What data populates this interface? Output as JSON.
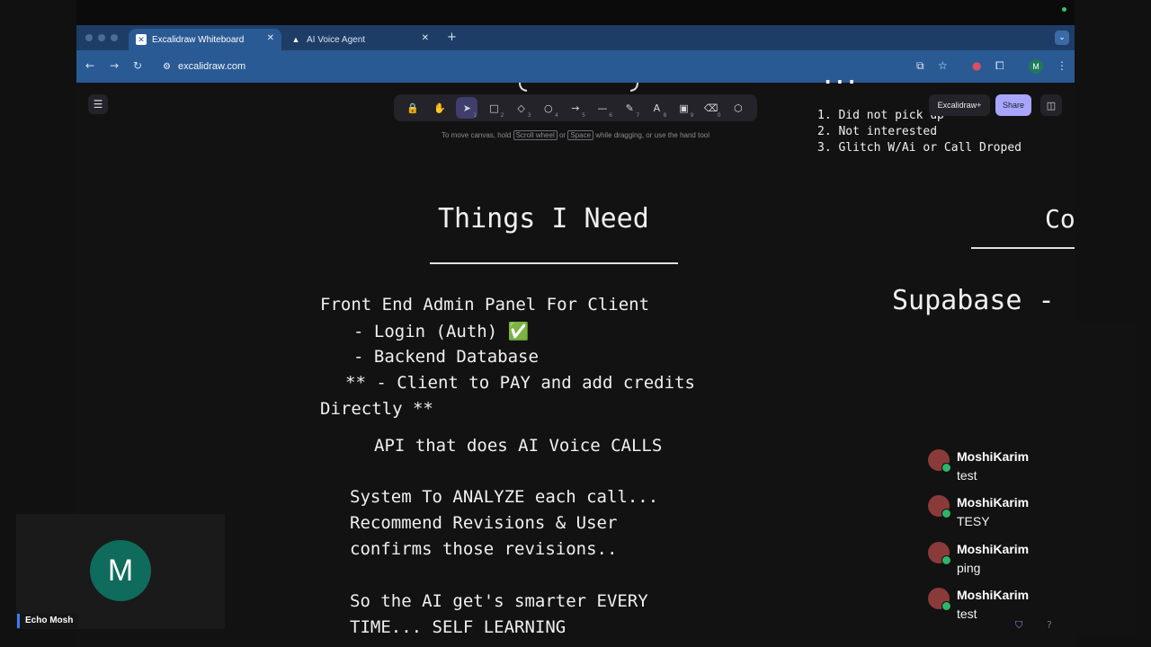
{
  "browser": {
    "tabs": [
      {
        "title": "Excalidraw Whiteboard",
        "icon": "excalidraw-icon",
        "active": true
      },
      {
        "title": "AI Voice Agent",
        "icon": "triangle-icon",
        "active": false
      }
    ],
    "new_tab_label": "+",
    "url": "excalidraw.com"
  },
  "toolbar": {
    "hint_prefix": "To move canvas, hold",
    "hint_key1": "Scroll wheel",
    "hint_or": "or",
    "hint_key2": "Space",
    "hint_suffix": "while dragging, or use the hand tool",
    "tools": [
      {
        "name": "lock-icon",
        "glyph": "🔒",
        "key": ""
      },
      {
        "name": "hand-icon",
        "glyph": "✋",
        "key": ""
      },
      {
        "name": "selection-icon",
        "glyph": "➤",
        "key": "1"
      },
      {
        "name": "rectangle-icon",
        "glyph": "□",
        "key": "2"
      },
      {
        "name": "diamond-icon",
        "glyph": "◇",
        "key": "3"
      },
      {
        "name": "ellipse-icon",
        "glyph": "○",
        "key": "4"
      },
      {
        "name": "arrow-icon",
        "glyph": "→",
        "key": "5"
      },
      {
        "name": "line-icon",
        "glyph": "—",
        "key": "6"
      },
      {
        "name": "draw-icon",
        "glyph": "✎",
        "key": "7"
      },
      {
        "name": "text-icon",
        "glyph": "A",
        "key": "8"
      },
      {
        "name": "image-icon",
        "glyph": "▣",
        "key": "9"
      },
      {
        "name": "eraser-icon",
        "glyph": "⌫",
        "key": "0"
      },
      {
        "name": "more-tools-icon",
        "glyph": "⬡",
        "key": ""
      }
    ]
  },
  "top_right": {
    "plus_label": "Excalidraw+",
    "share_label": "Share"
  },
  "canvas": {
    "top_fragment": "...",
    "reasons": [
      "1. Did not pick up",
      "2. Not interested",
      "3. Glitch W/Ai or Call Droped"
    ],
    "right_heading_fragment": "Co",
    "supabase_fragment": "Supabase -",
    "title": "Things I Need",
    "front_end": "Front End Admin Panel For Client",
    "login": "- Login (Auth) ✅",
    "backend": "- Backend Database",
    "pay": "** - Client to PAY and add credits",
    "directly": "Directly **",
    "api": "API that does AI Voice CALLS",
    "system1": "System To ANALYZE each call...",
    "system2": "Recommend Revisions & User",
    "system3": "confirms those revisions..",
    "smarter1": "So the AI get's smarter EVERY",
    "smarter2": "TIME... SELF LEARNING"
  },
  "chat": {
    "messages": [
      {
        "name": "MoshiKarim",
        "text": "test"
      },
      {
        "name": "MoshiKarim",
        "text": "TESY"
      },
      {
        "name": "MoshiKarim",
        "text": "ping"
      },
      {
        "name": "MoshiKarim",
        "text": "test"
      }
    ]
  },
  "participant": {
    "initial": "M",
    "name": "Echo Mosh"
  }
}
